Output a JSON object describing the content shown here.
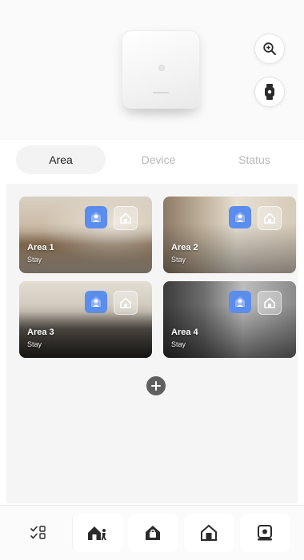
{
  "tabs": [
    {
      "label": "Area",
      "selected": true
    },
    {
      "label": "Device",
      "selected": false
    },
    {
      "label": "Status",
      "selected": false
    }
  ],
  "hero": {
    "device": "alarm-hub",
    "actions": [
      "zoom-in-icon",
      "watch-icon"
    ]
  },
  "areas": [
    {
      "name": "Area 1",
      "status": "Stay",
      "icons": [
        "user-icon",
        "home-icon"
      ]
    },
    {
      "name": "Area 2",
      "status": "Stay",
      "icons": [
        "user-icon",
        "home-icon"
      ]
    },
    {
      "name": "Area 3",
      "status": "Stay",
      "icons": [
        "user-icon",
        "home-icon"
      ]
    },
    {
      "name": "Area 4",
      "status": "Stay",
      "icons": [
        "user-icon",
        "home-icon"
      ]
    }
  ],
  "add_area": {
    "icon": "plus-icon"
  },
  "bottom_bar": {
    "buttons": [
      "batch-select-icon",
      "disarm-icon",
      "away-arm-icon",
      "stay-arm-icon",
      "sos-icon"
    ]
  },
  "colors": {
    "accent_blue": "#5b8def",
    "active_tab_bg": "#f3f3f3",
    "inactive_tab_text": "#b8b8b8",
    "icon_dark": "#2b2b2b"
  }
}
